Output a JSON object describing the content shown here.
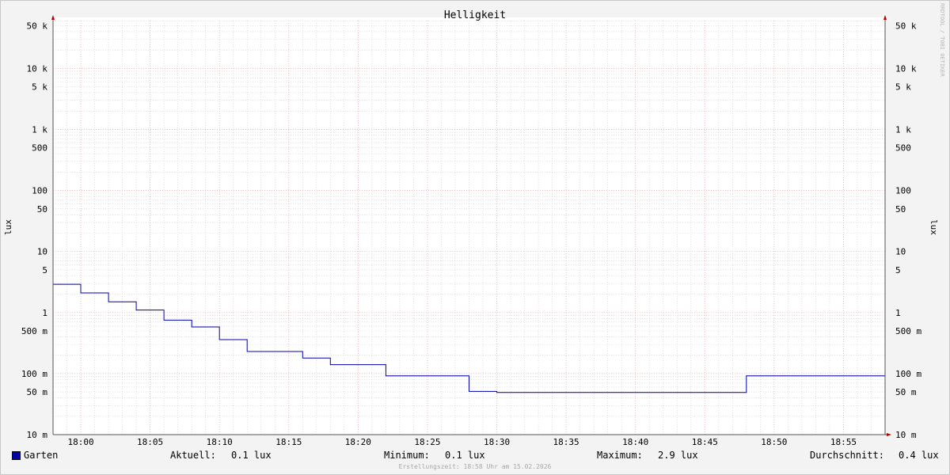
{
  "chart_data": {
    "type": "line",
    "title": "Helligkeit",
    "ylabel_left": "lux",
    "ylabel_right": "lux",
    "scale": "log",
    "ylim": [
      10,
      80000
    ],
    "xlim_minutes": [
      -2,
      58
    ],
    "x_ticks": [
      {
        "min": 0,
        "label": "18:00"
      },
      {
        "min": 5,
        "label": "18:05"
      },
      {
        "min": 10,
        "label": "18:10"
      },
      {
        "min": 15,
        "label": "18:15"
      },
      {
        "min": 20,
        "label": "18:20"
      },
      {
        "min": 25,
        "label": "18:25"
      },
      {
        "min": 30,
        "label": "18:30"
      },
      {
        "min": 35,
        "label": "18:35"
      },
      {
        "min": 40,
        "label": "18:40"
      },
      {
        "min": 45,
        "label": "18:45"
      },
      {
        "min": 50,
        "label": "18:50"
      },
      {
        "min": 55,
        "label": "18:55"
      }
    ],
    "y_ticks": [
      {
        "v": 50000,
        "label": "50 k"
      },
      {
        "v": 10000,
        "label": "10 k"
      },
      {
        "v": 5000,
        "label": "5 k"
      },
      {
        "v": 1000,
        "label": "1 k"
      },
      {
        "v": 500,
        "label": "500"
      },
      {
        "v": 100,
        "label": "100"
      },
      {
        "v": 50,
        "label": "50"
      },
      {
        "v": 10,
        "label": "10"
      },
      {
        "v": 5,
        "label": "5"
      },
      {
        "v": 1,
        "label": "1"
      },
      {
        "v": 0.5,
        "label": "500 m"
      },
      {
        "v": 0.1,
        "label": "100 m"
      },
      {
        "v": 0.05,
        "label": "50 m"
      },
      {
        "v": 0.01,
        "label": "10 m"
      }
    ],
    "series": [
      {
        "name": "Garten",
        "color": "#0000aa",
        "steps": [
          [
            -2,
            2.9
          ],
          [
            0,
            2.1
          ],
          [
            2,
            1.5
          ],
          [
            4,
            1.1
          ],
          [
            6,
            0.75
          ],
          [
            8,
            0.58
          ],
          [
            10,
            0.36
          ],
          [
            12,
            0.23
          ],
          [
            16,
            0.18
          ],
          [
            18,
            0.14
          ],
          [
            22,
            0.092
          ],
          [
            28,
            0.051
          ],
          [
            30,
            0.049
          ],
          [
            48,
            0.092
          ],
          [
            58,
            0.092
          ]
        ]
      }
    ],
    "legend": {
      "series_name": "Garten",
      "aktuell_label": "Aktuell:",
      "aktuell_value": "0.1 lux",
      "minimum_label": "Minimum:",
      "minimum_value": "0.1 lux",
      "maximum_label": "Maximum:",
      "maximum_value": "2.9 lux",
      "durchschnitt_label": "Durchschnitt:",
      "durchschnitt_value": "0.4 lux"
    },
    "footer": "Erstellungszeit: 18:58 Uhr am 15.02.2026",
    "watermark": "RRDTOOL / TOBI OETIKER",
    "grid": true,
    "colors": {
      "major_grid": "#e8a0a0",
      "minor_grid": "#c8c8c8",
      "axis": "#555555",
      "arrow": "#aa0000"
    }
  }
}
